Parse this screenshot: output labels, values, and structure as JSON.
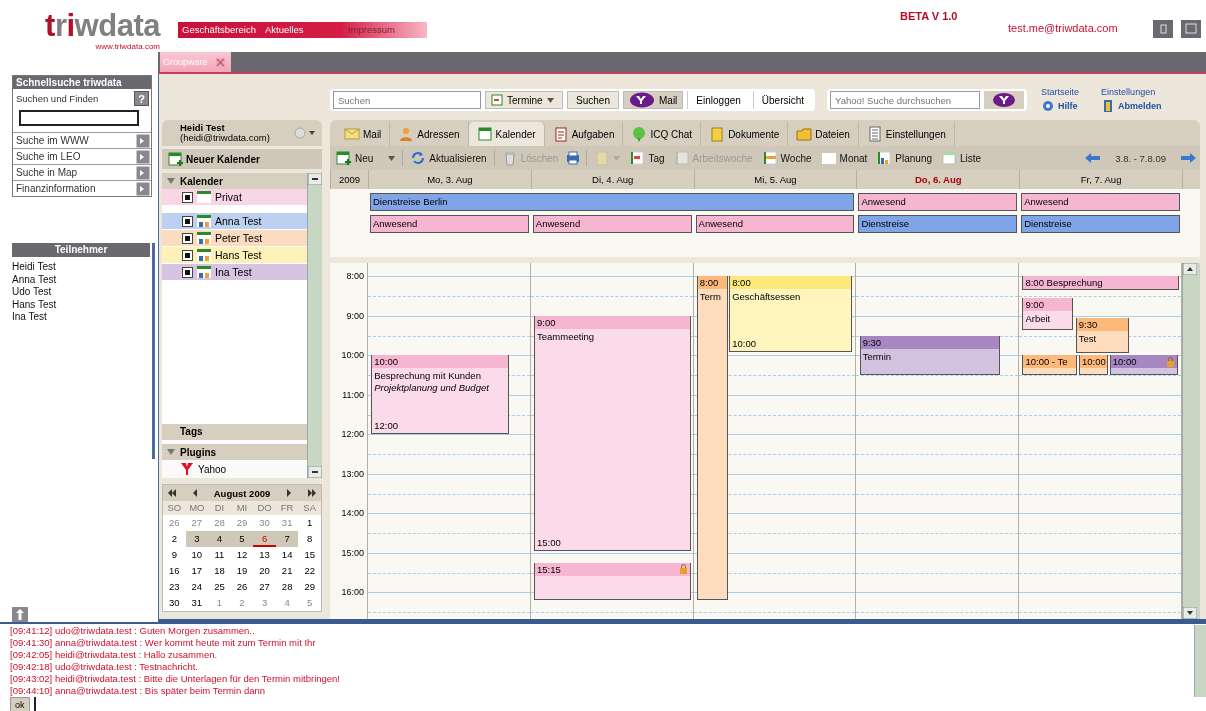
{
  "header": {
    "logo": "triwdata",
    "logo_url": "www.triwdata.com",
    "nav": [
      "Geschäftsbereich",
      "Aktuelles",
      "Impressum"
    ],
    "version": "BETA V 1.0",
    "user": "test.me@triwdata.com"
  },
  "sidebar": {
    "quicksearch": {
      "title": "Schnellsuche triwdata",
      "label": "Suchen und Finden",
      "help": "?",
      "links": [
        "Suche im WWW",
        "Suche im LEO",
        "Suche in Map",
        "Finanzinformation"
      ]
    },
    "participants": {
      "title": "Teilnehmer",
      "names": [
        "Heidi Test",
        "Anna Test",
        "Udo Test",
        "Hans Test",
        "Ina Test"
      ]
    }
  },
  "tabs": [
    {
      "label": "Groupware",
      "selected": true
    }
  ],
  "topbar": {
    "search_placeholder": "Suchen",
    "scope": "Termine",
    "search_button": "Suchen",
    "mail_button": "Mail",
    "buttons": [
      "Einloggen",
      "Übersicht"
    ],
    "yahoo_placeholder": "Yahoo! Suche durchsuchen",
    "links": [
      "Startseite",
      "Einstellungen"
    ],
    "help": "Hilfe",
    "logout": "Abmelden"
  },
  "account": {
    "name": "Heidi Test",
    "email": "(heidi@triwdata.com)"
  },
  "new_calendar": "Neuer Kalender",
  "calendars": {
    "title": "Kalender",
    "expanded": true,
    "items": [
      {
        "label": "Privat",
        "checked": true,
        "color": "#f9d6e6"
      },
      {
        "label": "Anna Test",
        "checked": true,
        "color": "#bcd0f0"
      },
      {
        "label": "Peter Test",
        "checked": true,
        "color": "#fcdcc0"
      },
      {
        "label": "Hans Test",
        "checked": true,
        "color": "#fdf0b8"
      },
      {
        "label": "Ina Test",
        "checked": true,
        "color": "#d6c4e2"
      }
    ]
  },
  "tags": {
    "title": "Tags"
  },
  "plugins": {
    "title": "Plugins",
    "expanded": true,
    "items": [
      "Yahoo"
    ]
  },
  "minical": {
    "title": "August 2009",
    "weekdays": [
      "SO",
      "MO",
      "DI",
      "MI",
      "DO",
      "FR",
      "SA"
    ],
    "weeks": [
      {
        "selected": false,
        "days": [
          {
            "day": "26",
            "other_month": true,
            "today": false
          },
          {
            "day": "27",
            "other_month": true,
            "today": false
          },
          {
            "day": "28",
            "other_month": true,
            "today": false
          },
          {
            "day": "29",
            "other_month": true,
            "today": false
          },
          {
            "day": "30",
            "other_month": true,
            "today": false
          },
          {
            "day": "31",
            "other_month": true,
            "today": false
          },
          {
            "day": "1",
            "other_month": false,
            "today": false
          }
        ]
      },
      {
        "selected": true,
        "days": [
          {
            "day": "2",
            "other_month": false,
            "today": false
          },
          {
            "day": "3",
            "other_month": false,
            "today": false
          },
          {
            "day": "4",
            "other_month": false,
            "today": false
          },
          {
            "day": "5",
            "other_month": false,
            "today": false
          },
          {
            "day": "6",
            "other_month": false,
            "today": true
          },
          {
            "day": "7",
            "other_month": false,
            "today": false
          },
          {
            "day": "8",
            "other_month": false,
            "today": false
          }
        ]
      },
      {
        "selected": false,
        "days": [
          {
            "day": "9",
            "other_month": false,
            "today": false
          },
          {
            "day": "10",
            "other_month": false,
            "today": false
          },
          {
            "day": "11",
            "other_month": false,
            "today": false
          },
          {
            "day": "12",
            "other_month": false,
            "today": false
          },
          {
            "day": "13",
            "other_month": false,
            "today": false
          },
          {
            "day": "14",
            "other_month": false,
            "today": false
          },
          {
            "day": "15",
            "other_month": false,
            "today": false
          }
        ]
      },
      {
        "selected": false,
        "days": [
          {
            "day": "16",
            "other_month": false,
            "today": false
          },
          {
            "day": "17",
            "other_month": false,
            "today": false
          },
          {
            "day": "18",
            "other_month": false,
            "today": false
          },
          {
            "day": "19",
            "other_month": false,
            "today": false
          },
          {
            "day": "20",
            "other_month": false,
            "today": false
          },
          {
            "day": "21",
            "other_month": false,
            "today": false
          },
          {
            "day": "22",
            "other_month": false,
            "today": false
          }
        ]
      },
      {
        "selected": false,
        "days": [
          {
            "day": "23",
            "other_month": false,
            "today": false
          },
          {
            "day": "24",
            "other_month": false,
            "today": false
          },
          {
            "day": "25",
            "other_month": false,
            "today": false
          },
          {
            "day": "26",
            "other_month": false,
            "today": false
          },
          {
            "day": "27",
            "other_month": false,
            "today": false
          },
          {
            "day": "28",
            "other_month": false,
            "today": false
          },
          {
            "day": "29",
            "other_month": false,
            "today": false
          }
        ]
      },
      {
        "selected": false,
        "days": [
          {
            "day": "30",
            "other_month": false,
            "today": false
          },
          {
            "day": "31",
            "other_month": false,
            "today": false
          },
          {
            "day": "1",
            "other_month": true,
            "today": false
          },
          {
            "day": "2",
            "other_month": true,
            "today": false
          },
          {
            "day": "3",
            "other_month": true,
            "today": false
          },
          {
            "day": "4",
            "other_month": true,
            "today": false
          },
          {
            "day": "5",
            "other_month": true,
            "today": false
          }
        ]
      }
    ]
  },
  "modules": [
    {
      "label": "Mail",
      "selected": false
    },
    {
      "label": "Adressen",
      "selected": false
    },
    {
      "label": "Kalender",
      "selected": true
    },
    {
      "label": "Aufgaben",
      "selected": false
    },
    {
      "label": "ICQ Chat",
      "selected": false
    },
    {
      "label": "Dokumente",
      "selected": false
    },
    {
      "label": "Dateien",
      "selected": false
    },
    {
      "label": "Einstellungen",
      "selected": false
    }
  ],
  "toolbar": [
    {
      "kind": "menu",
      "label": "Neu",
      "disabled": false
    },
    {
      "kind": "button",
      "label": "Aktualisieren",
      "disabled": false
    },
    {
      "kind": "button",
      "label": "Löschen",
      "disabled": true
    },
    {
      "kind": "icon",
      "disabled": false
    },
    {
      "kind": "menu",
      "disabled": true
    },
    {
      "kind": "view",
      "label": "Tag",
      "selected": false
    },
    {
      "kind": "view",
      "label": "Arbeitswoche",
      "selected": true
    },
    {
      "kind": "view",
      "label": "Woche",
      "selected": false
    },
    {
      "kind": "view",
      "label": "Monat",
      "selected": false
    },
    {
      "kind": "view",
      "label": "Planung",
      "selected": false
    },
    {
      "kind": "view",
      "label": "Liste",
      "selected": false
    }
  ],
  "range": "3.8. - 7.8.09",
  "calendar": {
    "year": "2009",
    "days": [
      {
        "label": "Mo, 3. Aug",
        "today": false
      },
      {
        "label": "Di, 4. Aug",
        "today": false
      },
      {
        "label": "Mi, 5. Aug",
        "today": false
      },
      {
        "label": "Do, 6. Aug",
        "today": true
      },
      {
        "label": "Fr, 7. Aug",
        "today": false
      }
    ],
    "allday": [
      {
        "title": "Dienstreise Berlin",
        "color": "#7fa4e8"
      },
      {
        "title": "Anwesend",
        "color": "#f6b6d2"
      },
      {
        "title": "Anwesend",
        "color": "#f6b6d2"
      },
      {
        "title": "Anwesend",
        "color": "#f6b6d2"
      },
      {
        "title": "Anwesend",
        "color": "#f6b6d2"
      },
      {
        "title": "Anwesend",
        "color": "#f6b6d2"
      },
      {
        "title": "Dienstreise",
        "color": "#7fa4e8"
      },
      {
        "title": "Dienstreise",
        "color": "#7fa4e8"
      }
    ],
    "hours": [
      "8:00",
      "9:00",
      "10:00",
      "11:00",
      "12:00",
      "13:00",
      "14:00",
      "15:00",
      "16:00"
    ],
    "events": [
      {
        "start": "10:00",
        "title": "Besprechung mit Kunden",
        "note": "Projektplanung und Budget",
        "end": "12:00",
        "color": "#f6b6d2",
        "locked": false
      },
      {
        "start": "9:00",
        "title": "Teammeeting",
        "end": "15:00",
        "color": "#f6b6d2",
        "locked": false
      },
      {
        "start": "15:15",
        "color": "#f6b6d2",
        "locked": true
      },
      {
        "start": "8:00",
        "title": "Term",
        "color": "#fdb97a",
        "locked": false
      },
      {
        "start": "8:00",
        "title": "Geschäftsessen",
        "end": "10:00",
        "color": "#fde87a",
        "locked": false
      },
      {
        "start": "9:30",
        "title": "Termin",
        "color": "#a787c2",
        "locked": false
      },
      {
        "start": "8:00 Besprechung",
        "color": "#f6b6d2",
        "locked": false
      },
      {
        "start": "9:00",
        "title": "Arbeit",
        "color": "#f6b6d2",
        "locked": false
      },
      {
        "start": "9:30",
        "title": "Test",
        "color": "#fdb97a",
        "locked": false
      },
      {
        "start": "10:00 - Te",
        "color": "#fdb97a",
        "locked": false
      },
      {
        "start": "10:00",
        "color": "#fdb97a",
        "locked": false
      },
      {
        "start": "10:00",
        "color": "#a787c2",
        "locked": true
      }
    ]
  },
  "chat": {
    "lines": [
      "[09:41:12] udo@triwdata.test : Guten Morgen zusammen..",
      "[09:41:30] anna@triwdata.test : Wer kommt heute mit zum Termin mit Ihr",
      "[09:42:05] heidi@triwdata.test : Hallo zusammen.",
      "[09:42:18] udo@triwdata.test : Testnachricht.",
      "[09:43:02] heidi@triwdata.test : Bitte die Unterlagen für den Termin mitbringen!",
      "[09:44:10] anna@triwdata.test : Bis später beim Termin dann"
    ],
    "send": "ok"
  }
}
